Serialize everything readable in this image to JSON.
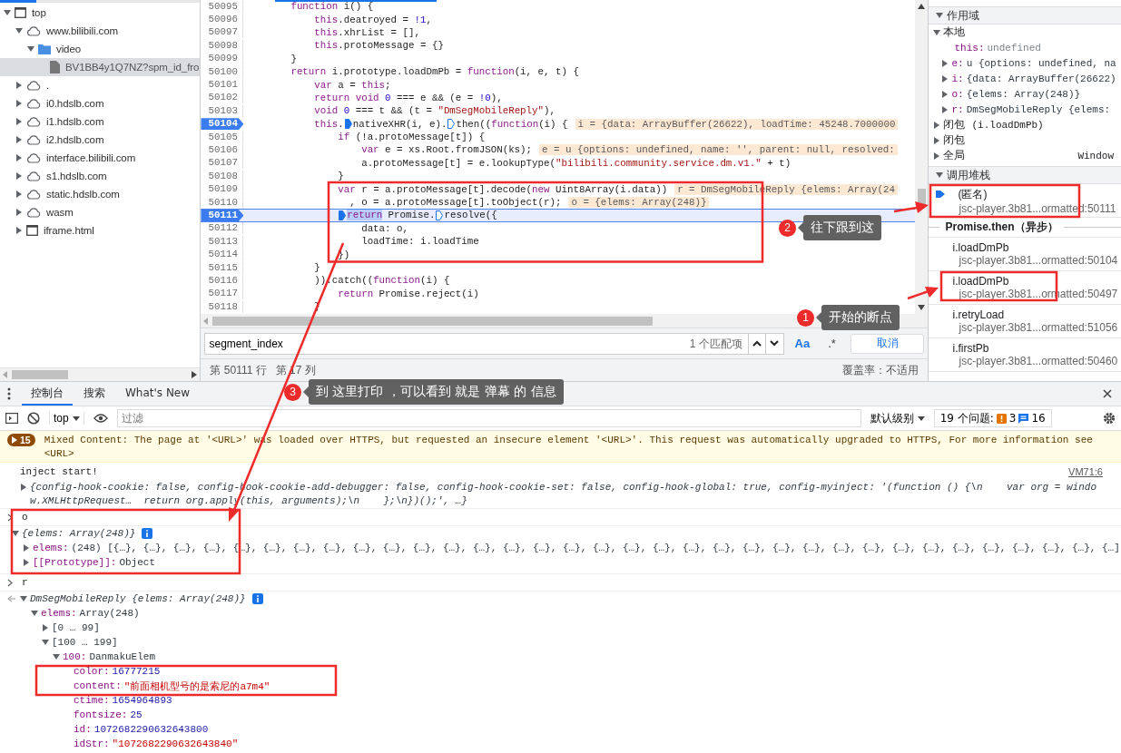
{
  "file_tree": [
    {
      "label": "top",
      "kind": "frame",
      "expanded": true,
      "selected": false,
      "children": [
        {
          "label": "www.bilibili.com",
          "kind": "cloud",
          "expanded": true,
          "selected": false,
          "children": [
            {
              "label": "video",
              "kind": "folder",
              "expanded": true,
              "selected": false,
              "children": [
                {
                  "label": "BV1BB4y1Q7NZ?spm_id_fro",
                  "kind": "file",
                  "selected": true
                }
              ]
            }
          ]
        },
        {
          "label": ".",
          "kind": "cloud",
          "expanded": false,
          "selected": false
        },
        {
          "label": "i0.hdslb.com",
          "kind": "cloud",
          "expanded": false,
          "selected": false
        },
        {
          "label": "i1.hdslb.com",
          "kind": "cloud",
          "expanded": false,
          "selected": false
        },
        {
          "label": "i2.hdslb.com",
          "kind": "cloud",
          "expanded": false,
          "selected": false
        },
        {
          "label": "interface.bilibili.com",
          "kind": "cloud",
          "expanded": false,
          "selected": false
        },
        {
          "label": "s1.hdslb.com",
          "kind": "cloud",
          "expanded": false,
          "selected": false
        },
        {
          "label": "static.hdslb.com",
          "kind": "cloud",
          "expanded": false,
          "selected": false
        },
        {
          "label": "wasm",
          "kind": "cloud",
          "expanded": false,
          "selected": false
        },
        {
          "label": "iframe.html",
          "kind": "frame",
          "expanded": false,
          "selected": false
        }
      ]
    }
  ],
  "editor": {
    "lines": [
      {
        "number": "50095",
        "breakpoint": false,
        "current": false,
        "tokens": [
          {
            "text": "    function",
            "kind": "kw"
          },
          {
            "text": " i() {",
            "kind": "plain"
          }
        ]
      },
      {
        "number": "50096",
        "breakpoint": false,
        "current": false,
        "tokens": [
          {
            "text": "        this",
            "kind": "kw"
          },
          {
            "text": ".deatroyed = ",
            "kind": "plain"
          },
          {
            "text": "!1",
            "kind": "num"
          },
          {
            "text": ",",
            "kind": "plain"
          }
        ]
      },
      {
        "number": "50097",
        "breakpoint": false,
        "current": false,
        "tokens": [
          {
            "text": "        this",
            "kind": "kw"
          },
          {
            "text": ".xhrList = [],",
            "kind": "plain"
          }
        ]
      },
      {
        "number": "50098",
        "breakpoint": false,
        "current": false,
        "tokens": [
          {
            "text": "        this",
            "kind": "kw"
          },
          {
            "text": ".protoMessage = {}",
            "kind": "plain"
          }
        ]
      },
      {
        "number": "50099",
        "breakpoint": false,
        "current": false,
        "tokens": [
          {
            "text": "    }",
            "kind": "plain"
          }
        ]
      },
      {
        "number": "50100",
        "breakpoint": false,
        "current": false,
        "tokens": [
          {
            "text": "    return",
            "kind": "kw"
          },
          {
            "text": " i.prototype.loadDmPb = ",
            "kind": "plain"
          },
          {
            "text": "function",
            "kind": "kw"
          },
          {
            "text": "(i, e, t) {",
            "kind": "plain"
          }
        ]
      },
      {
        "number": "50101",
        "breakpoint": false,
        "current": false,
        "tokens": [
          {
            "text": "        var",
            "kind": "kw"
          },
          {
            "text": " a = ",
            "kind": "plain"
          },
          {
            "text": "this",
            "kind": "kw"
          },
          {
            "text": ";",
            "kind": "plain"
          }
        ]
      },
      {
        "number": "50102",
        "breakpoint": false,
        "current": false,
        "tokens": [
          {
            "text": "        return void ",
            "kind": "kw"
          },
          {
            "text": "0",
            "kind": "num"
          },
          {
            "text": " === e && (e = ",
            "kind": "plain"
          },
          {
            "text": "!0",
            "kind": "num"
          },
          {
            "text": "),",
            "kind": "plain"
          }
        ]
      },
      {
        "number": "50103",
        "breakpoint": false,
        "current": false,
        "tokens": [
          {
            "text": "        void ",
            "kind": "kw"
          },
          {
            "text": "0",
            "kind": "num"
          },
          {
            "text": " === t && (t = ",
            "kind": "plain"
          },
          {
            "text": "\"DmSegMobileReply\"",
            "kind": "str"
          },
          {
            "text": "),",
            "kind": "plain"
          }
        ]
      },
      {
        "number": "50104",
        "breakpoint": true,
        "current": false,
        "hint": "i = {data: ArrayBuffer(26622), loadTime: 45248.7000000",
        "tokens": [
          {
            "text": "        this",
            "kind": "kw"
          },
          {
            "text": ".",
            "kind": "plain"
          },
          {
            "text": "nativeXHR(i, e).",
            "kind": "plain",
            "marker_active": true
          },
          {
            "text": "then((",
            "kind": "plain",
            "marker_active": false
          },
          {
            "text": "function",
            "kind": "kw"
          },
          {
            "text": "(i) {",
            "kind": "plain"
          }
        ]
      },
      {
        "number": "50105",
        "breakpoint": false,
        "current": false,
        "tokens": [
          {
            "text": "            if",
            "kind": "kw"
          },
          {
            "text": " (!a.protoMessage[t]) {",
            "kind": "plain"
          }
        ]
      },
      {
        "number": "50106",
        "breakpoint": false,
        "current": false,
        "hint": "e = u {options: undefined, name: '', parent: null, resolved:",
        "tokens": [
          {
            "text": "                var",
            "kind": "kw"
          },
          {
            "text": " e = xs.Root.fromJSON(ks);",
            "kind": "plain"
          }
        ]
      },
      {
        "number": "50107",
        "breakpoint": false,
        "current": false,
        "tokens": [
          {
            "text": "                a.protoMessage[t] = e.lookupType(",
            "kind": "plain"
          },
          {
            "text": "\"bilibili.community.service.dm.v1.\"",
            "kind": "str"
          },
          {
            "text": " + t)",
            "kind": "plain"
          }
        ]
      },
      {
        "number": "50108",
        "breakpoint": false,
        "current": false,
        "tokens": [
          {
            "text": "            }",
            "kind": "plain"
          }
        ]
      },
      {
        "number": "50109",
        "breakpoint": false,
        "current": false,
        "hint": "r = DmSegMobileReply {elems: Array(24",
        "tokens": [
          {
            "text": "            var",
            "kind": "kw"
          },
          {
            "text": " r = a.protoMessage[t].decode(",
            "kind": "plain"
          },
          {
            "text": "new",
            "kind": "kw"
          },
          {
            "text": " Uint8Array(i.data))",
            "kind": "plain"
          }
        ]
      },
      {
        "number": "50110",
        "breakpoint": false,
        "current": false,
        "hint": "o = {elems: Array(248)}",
        "tokens": [
          {
            "text": "              , o = a.protoMessage[t].toObject(r);",
            "kind": "plain"
          }
        ]
      },
      {
        "number": "50111",
        "breakpoint": true,
        "current": true,
        "tokens": [
          {
            "text": "            return",
            "kind": "paused",
            "marker_active": true
          },
          {
            "text": " Promise.",
            "kind": "plain"
          },
          {
            "text": "resolve({",
            "kind": "plain",
            "marker_active": false
          }
        ]
      },
      {
        "number": "50112",
        "breakpoint": false,
        "current": false,
        "tokens": [
          {
            "text": "                data: o,",
            "kind": "plain"
          }
        ]
      },
      {
        "number": "50113",
        "breakpoint": false,
        "current": false,
        "tokens": [
          {
            "text": "                loadTime: i.loadTime",
            "kind": "plain"
          }
        ]
      },
      {
        "number": "50114",
        "breakpoint": false,
        "current": false,
        "tokens": [
          {
            "text": "            })",
            "kind": "plain"
          }
        ]
      },
      {
        "number": "50115",
        "breakpoint": false,
        "current": false,
        "tokens": [
          {
            "text": "        }",
            "kind": "plain"
          }
        ]
      },
      {
        "number": "50116",
        "breakpoint": false,
        "current": false,
        "tokens": [
          {
            "text": "        )).catch((",
            "kind": "plain"
          },
          {
            "text": "function",
            "kind": "kw"
          },
          {
            "text": "(i) {",
            "kind": "plain"
          }
        ]
      },
      {
        "number": "50117",
        "breakpoint": false,
        "current": false,
        "tokens": [
          {
            "text": "            return",
            "kind": "kw"
          },
          {
            "text": " Promise.reject(i)",
            "kind": "plain"
          }
        ]
      },
      {
        "number": "50118",
        "breakpoint": false,
        "current": false,
        "tokens": [
          {
            "text": "        }",
            "kind": "plain"
          }
        ]
      }
    ],
    "search": {
      "value": "segment_index",
      "match_count": "1 个匹配项",
      "toggles": [
        {
          "label": "Aa",
          "on": true
        },
        {
          "label": ".*",
          "on": false
        }
      ],
      "cancel": "取消"
    },
    "status": {
      "line": "第 50111 行",
      "column": "第 17 列",
      "coverage": "覆盖率：不适用"
    }
  },
  "scope": {
    "title": "作用域",
    "expanded": true,
    "groups": [
      {
        "label": "本地",
        "expanded": true,
        "vars": [
          {
            "name": "this:",
            "value": "undefined",
            "kind": "undefined",
            "expandable": false
          },
          {
            "name": "e:",
            "value": "u {options: undefined, na",
            "kind": "object",
            "expandable": true
          },
          {
            "name": "i:",
            "value": "{data: ArrayBuffer(26622)",
            "kind": "object",
            "expandable": true
          },
          {
            "name": "o:",
            "value": "{elems: Array(248)}",
            "kind": "object",
            "expandable": true
          },
          {
            "name": "r:",
            "value": "DmSegMobileReply {elems:",
            "kind": "object",
            "expandable": true
          }
        ]
      },
      {
        "label": "闭包",
        "detail": "(i.loadDmPb)",
        "expanded": false
      },
      {
        "label": "闭包",
        "expanded": false
      },
      {
        "label": "全局",
        "value": "Window",
        "expanded": false
      }
    ]
  },
  "call_stack": {
    "title": "调用堆栈",
    "expanded": true,
    "frames": [
      {
        "kind": "frame",
        "name": "(匿名)",
        "location": "jsc-player.3b81...ormatted:50111",
        "current": true
      },
      {
        "kind": "async",
        "label": "Promise.then（异步）"
      },
      {
        "kind": "frame",
        "name": "i.loadDmPb",
        "location": "jsc-player.3b81...ormatted:50104",
        "current": false
      },
      {
        "kind": "frame",
        "name": "i.loadDmPb",
        "location": "jsc-player.3b81...ormatted:50497",
        "current": false
      },
      {
        "kind": "frame",
        "name": "i.retryLoad",
        "location": "jsc-player.3b81...ormatted:51056",
        "current": false
      },
      {
        "kind": "frame",
        "name": "i.firstPb",
        "location": "jsc-player.3b81...ormatted:50460",
        "current": false
      }
    ]
  },
  "console": {
    "tabs": [
      {
        "label": "控制台",
        "selected": true
      },
      {
        "label": "搜索",
        "selected": false
      },
      {
        "label": "What's New",
        "selected": false
      }
    ],
    "context": "top",
    "filter": {
      "placeholder": "过滤"
    },
    "level": "默认级别",
    "issues": {
      "label": "19 个问题:",
      "warnings": "3",
      "infos": "16"
    },
    "messages": [
      {
        "kind": "warning",
        "count": "15",
        "text": "Mixed Content: The page at '<URL>' was loaded over HTTPS, but requested an insecure element '<URL>'. This request was automatically upgraded to HTTPS, For more information see <URL>"
      },
      {
        "kind": "log",
        "text": "inject start!",
        "source": "VM71:6"
      },
      {
        "kind": "object",
        "expanded": false,
        "text": "{config-hook-cookie: false, config-hook-cookie-add-debugger: false, config-hook-cookie-set: false, config-hook-global: true, config-myinject: '(function () {\\n    var org = window.XMLHttpRequest…  return org.apply(this, arguments);\\n    };\\n})();', …}"
      },
      {
        "kind": "input",
        "text": "o"
      },
      {
        "kind": "result",
        "tree": {
          "kind": "root",
          "label": "{elems: Array(248)}",
          "info": true,
          "expanded": true,
          "children": [
            {
              "kind": "object",
              "key": "elems:",
              "value": "(248) [{…}, {…}, {…}, {…}, {…}, {…}, {…}, {…}, {…}, {…}, {…}, {…}, {…}, {…}, {…}, {…}, {…}, {…}, {…}, {…}, {…}, {…}, {…}, {…}, {…}, {…}, {…}, {…}, {…}, {…}, {…}, {…}, {…}, {…]",
              "expanded": false
            },
            {
              "kind": "object",
              "key": "[[Prototype]]:",
              "value": "Object",
              "expanded": false
            }
          ]
        }
      },
      {
        "kind": "input",
        "text": "r"
      },
      {
        "kind": "result",
        "tree": {
          "kind": "root",
          "label": "DmSegMobileReply {elems: Array(248)}",
          "info": true,
          "expanded": true,
          "children": [
            {
              "kind": "object",
              "key": "elems:",
              "value": "Array(248)",
              "expanded": true,
              "children": [
                {
                  "kind": "range",
                  "label": "[0 … 99]",
                  "expanded": false
                },
                {
                  "kind": "range",
                  "label": "[100 … 199]",
                  "expanded": true,
                  "children": [
                    {
                      "kind": "object",
                      "key": "100:",
                      "value": "DanmakuElem",
                      "expanded": true,
                      "children": [
                        {
                          "kind": "number",
                          "key": "color:",
                          "value": "16777215"
                        },
                        {
                          "kind": "string",
                          "key": "content:",
                          "value": "\"前面相机型号的是索尼的a7m4\""
                        },
                        {
                          "kind": "number",
                          "key": "ctime:",
                          "value": "1654964893"
                        },
                        {
                          "kind": "number",
                          "key": "fontsize:",
                          "value": "25"
                        },
                        {
                          "kind": "number",
                          "key": "id:",
                          "value": "1072682290632643800"
                        },
                        {
                          "kind": "string",
                          "key": "idStr:",
                          "value": "\"1072682290632643840\""
                        }
                      ]
                    }
                  ]
                }
              ]
            }
          ]
        }
      }
    ]
  },
  "annotations": [
    {
      "number": "2",
      "text": "往下跟到这"
    },
    {
      "number": "1",
      "text": "开始的断点"
    },
    {
      "number": "3",
      "text": "到 这里打印 ，可以看到 就是 弹幕 的 信息"
    }
  ]
}
